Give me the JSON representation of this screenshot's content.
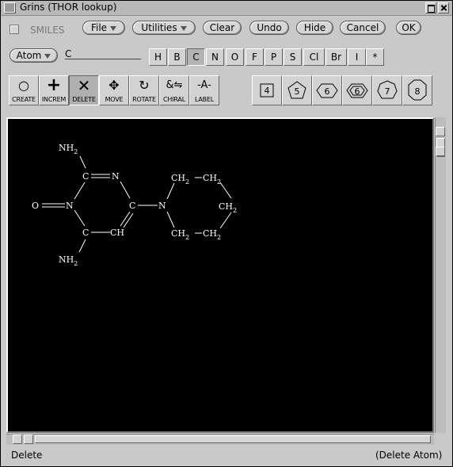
{
  "window": {
    "title": "Grins (THOR lookup)"
  },
  "toolbar": {
    "smiles_label": "SMILES",
    "file_label": "File",
    "utilities_label": "Utilities",
    "clear_label": "Clear",
    "undo_label": "Undo",
    "hide_label": "Hide",
    "cancel_label": "Cancel",
    "ok_label": "OK"
  },
  "atom": {
    "mode_label": "Atom",
    "current_value": "C",
    "elements": [
      "H",
      "B",
      "C",
      "N",
      "O",
      "F",
      "P",
      "S",
      "Cl",
      "Br",
      "I",
      "*"
    ],
    "selected": "C"
  },
  "tools": [
    {
      "label": "CREATE",
      "icon": "circle-icon"
    },
    {
      "label": "INCREM",
      "icon": "plus-icon"
    },
    {
      "label": "DELETE",
      "icon": "x-icon"
    },
    {
      "label": "MOVE",
      "icon": "move-arrows-icon"
    },
    {
      "label": "ROTATE",
      "icon": "rotate-icon"
    },
    {
      "label": "CHIRAL",
      "icon": "chiral-icon"
    },
    {
      "label": "LABEL",
      "icon": "label-icon"
    }
  ],
  "selected_tool": "DELETE",
  "rings": [
    "4",
    "5",
    "6",
    "6",
    "7",
    "8"
  ],
  "molecule": {
    "atoms": [
      "NH2",
      "C",
      "N",
      "O",
      "N",
      "C",
      "C",
      "CH",
      "NH2",
      "N",
      "CH2",
      "CH2",
      "CH2",
      "CH2",
      "CH2"
    ],
    "bond_color": "#ffffff",
    "background": "#000000"
  },
  "status": {
    "left": "Delete",
    "right": "(Delete Atom)"
  }
}
